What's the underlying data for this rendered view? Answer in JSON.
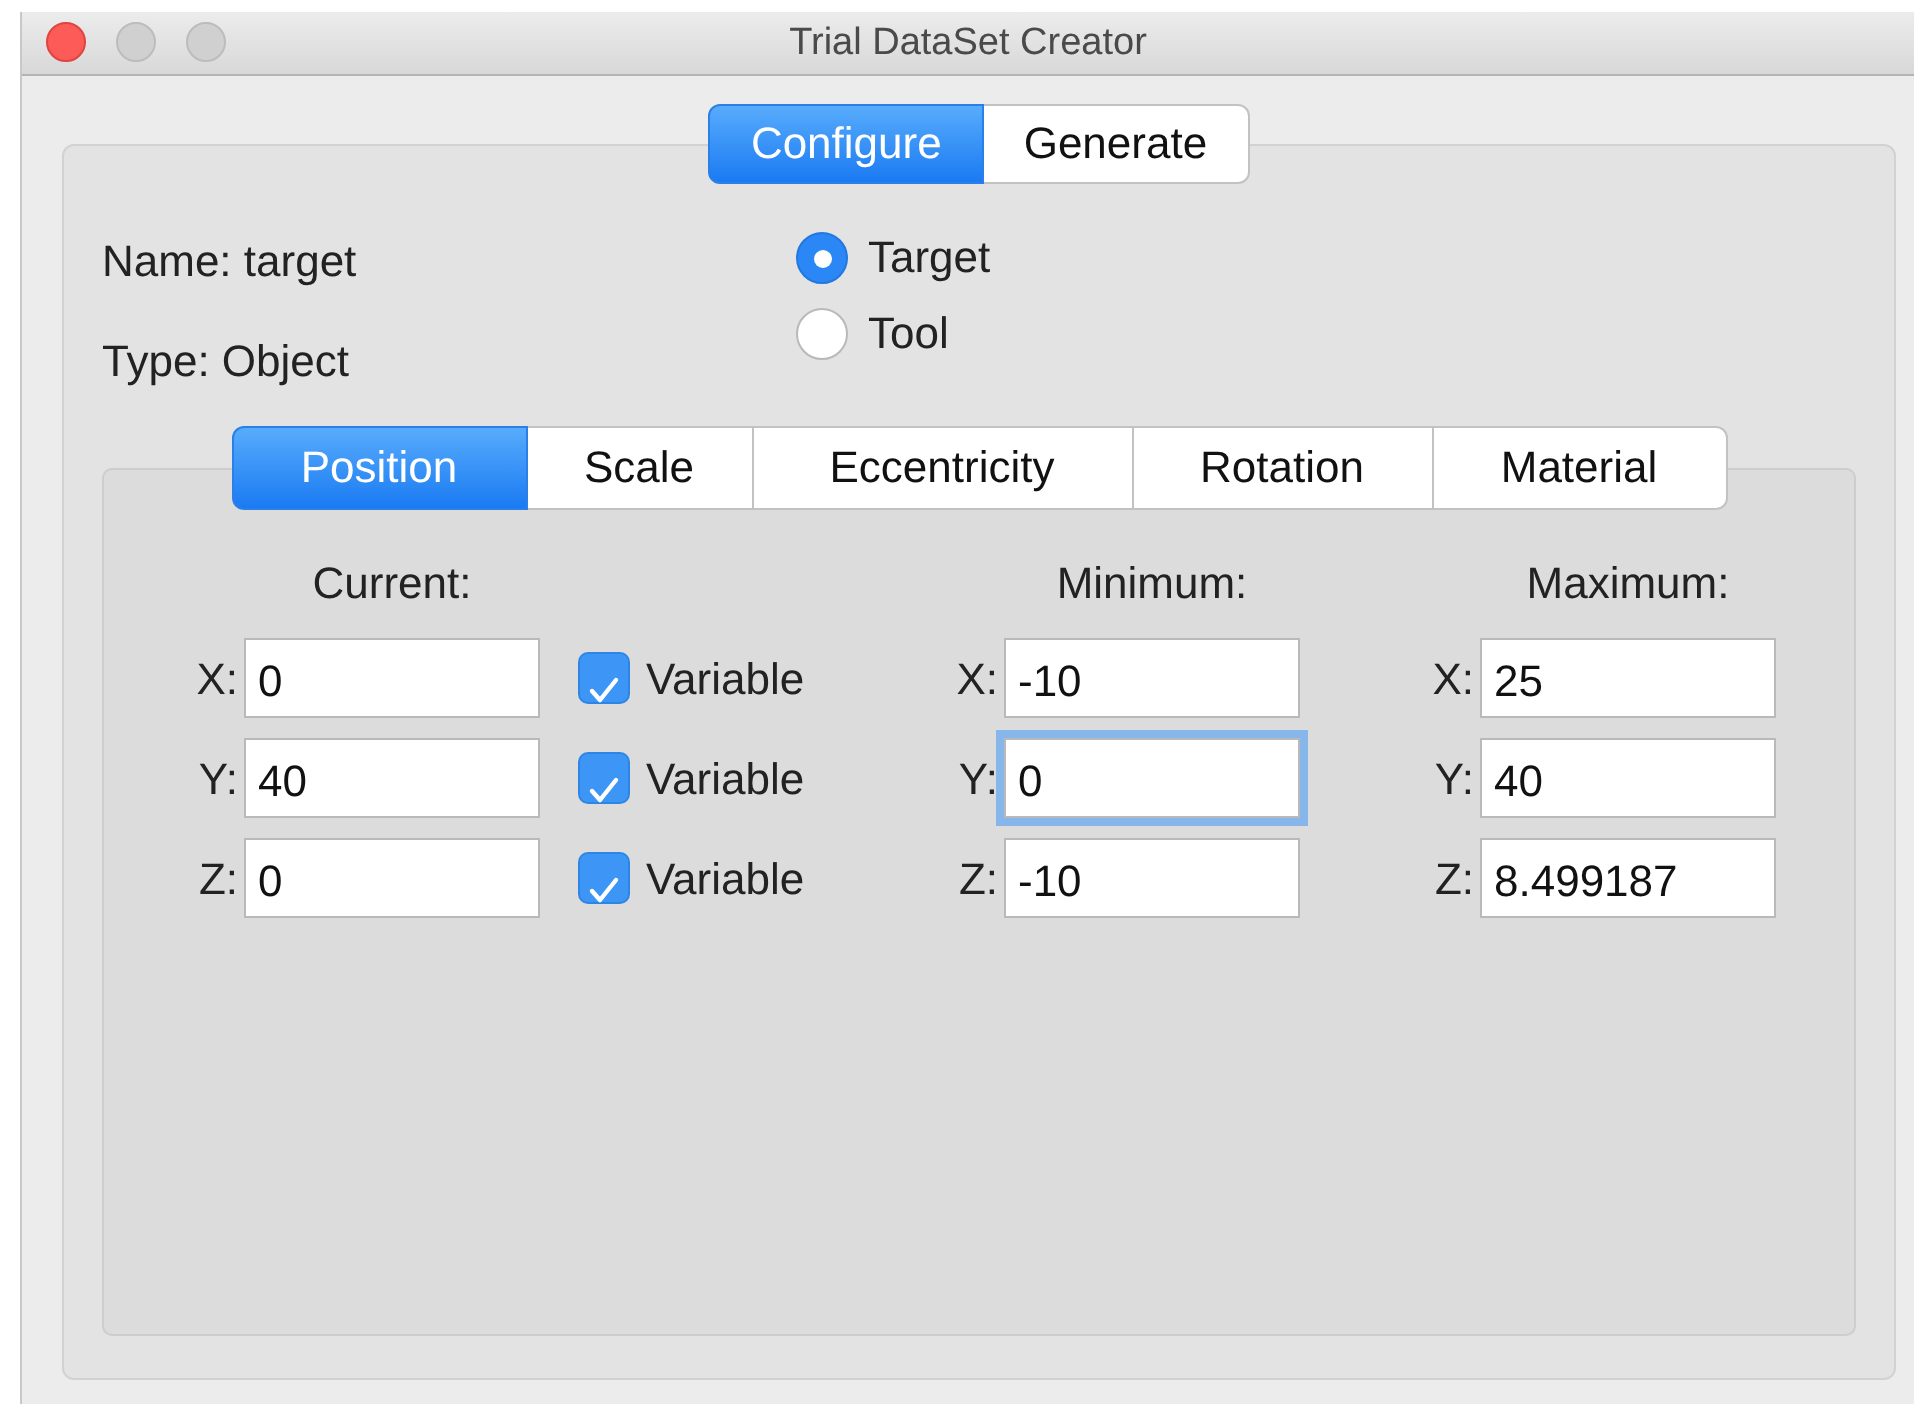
{
  "window": {
    "title": "Trial DataSet Creator"
  },
  "mode_tabs": [
    {
      "label": "Configure",
      "selected": true
    },
    {
      "label": "Generate",
      "selected": false
    }
  ],
  "info": [
    "Name: target",
    "Type: Object"
  ],
  "role_options": [
    {
      "label": "Target",
      "selected": true
    },
    {
      "label": "Tool",
      "selected": false
    }
  ],
  "property_tabs": [
    {
      "label": "Position",
      "selected": true
    },
    {
      "label": "Scale",
      "selected": false
    },
    {
      "label": "Eccentricity",
      "selected": false
    },
    {
      "label": "Rotation",
      "selected": false
    },
    {
      "label": "Material",
      "selected": false
    }
  ],
  "column_headers": {
    "current": "Current:",
    "minimum": "Minimum:",
    "maximum": "Maximum:"
  },
  "rows": [
    {
      "current_axis": "X:",
      "current": "0",
      "variable": {
        "label": "Variable",
        "checked": true
      },
      "minimum_axis": "X:",
      "minimum": "-10",
      "minimum_focused": false,
      "maximum_axis": "X:",
      "maximum": "25"
    },
    {
      "current_axis": "Y:",
      "current": "40",
      "variable": {
        "label": "Variable",
        "checked": true
      },
      "minimum_axis": "Y:",
      "minimum": "0",
      "minimum_focused": true,
      "maximum_axis": "Y:",
      "maximum": "40"
    },
    {
      "current_axis": "Z:",
      "current": "0",
      "variable": {
        "label": "Variable",
        "checked": true
      },
      "minimum_axis": "Z:",
      "minimum": "-10",
      "minimum_focused": false,
      "maximum_axis": "Z:",
      "maximum": "8.499187"
    }
  ]
}
